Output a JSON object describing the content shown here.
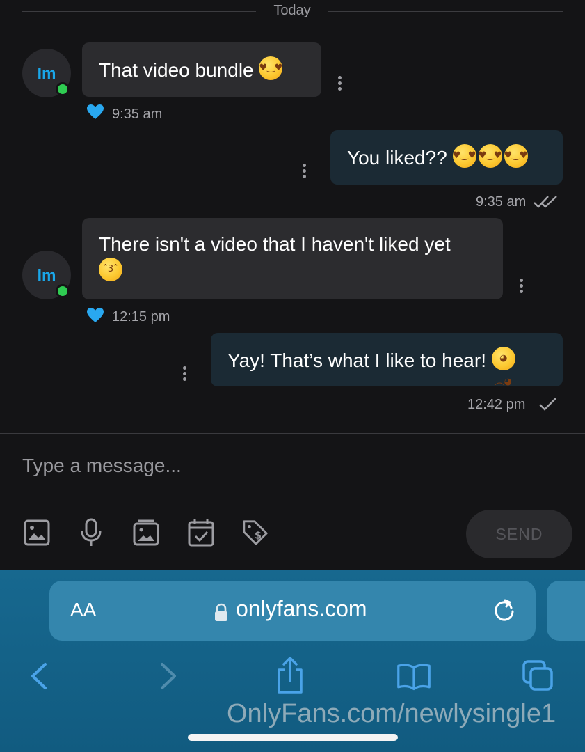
{
  "chat": {
    "date_separator": "Today",
    "messages": [
      {
        "direction": "in",
        "avatar_initials": "Im",
        "text": "That video bundle",
        "emojis": [
          "heart-eyes-emoji"
        ],
        "time": "9:35 am",
        "liked": true
      },
      {
        "direction": "out",
        "text": "You liked??",
        "emojis": [
          "smiling-face-with-hearts-emoji",
          "smiling-face-with-hearts-emoji",
          "smiling-face-with-hearts-emoji"
        ],
        "time": "9:35 am",
        "status": "read"
      },
      {
        "direction": "in",
        "avatar_initials": "Im",
        "text": "There isn't a video that I haven't liked yet",
        "emojis": [
          "kissing-heart-emoji"
        ],
        "time": "12:15 pm",
        "liked": true
      },
      {
        "direction": "out",
        "text": "Yay! That’s what I like to hear!",
        "emojis": [
          "pleading-face-emoji"
        ],
        "time": "12:42 pm",
        "status": "sent"
      }
    ]
  },
  "composer": {
    "placeholder": "Type a message...",
    "value": "",
    "tools": [
      "image-icon",
      "microphone-icon",
      "media-vault-icon",
      "schedule-calendar-icon",
      "price-tag-icon"
    ],
    "send_label": "SEND"
  },
  "browser": {
    "text_size_label": "AA",
    "url": "onlyfans.com",
    "nav": [
      "back-icon",
      "forward-icon",
      "share-icon",
      "bookmarks-icon",
      "tabs-icon"
    ],
    "watermark": "OnlyFans.com/newlysingle1"
  },
  "colors": {
    "background": "#141416",
    "incoming_bubble": "#2c2c2f",
    "outgoing_bubble": "#1b2a34",
    "accent_blue": "#1aa6e8",
    "online_green": "#2fcc52",
    "browser_bar": "#17688f"
  }
}
